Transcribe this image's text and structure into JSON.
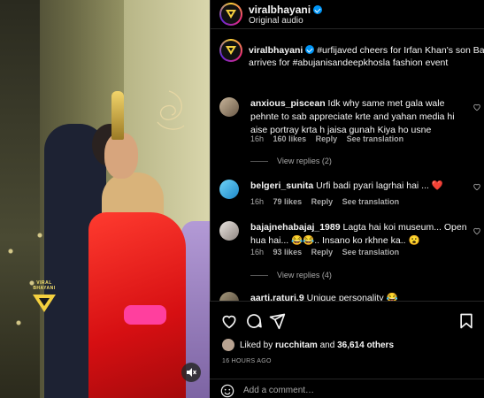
{
  "post": {
    "username": "viralbhayani",
    "audio": "Original audio",
    "caption_prefix": "#urfijaved cheers for Irfan Khan's son Babil as s",
    "caption_line2": "arrives for #abujanisandeepkhosla fashion event",
    "watermark": "VIRAL BHAYANI"
  },
  "comments": [
    {
      "username": "anxious_piscean",
      "text": "Idk why same met gala wale pehnte to sab appreciate krte and yahan media hi aise portray krta h jaisa gunah Kiya ho usne",
      "time": "16h",
      "likes": "160 likes",
      "reply": "Reply",
      "translation": "See translation",
      "view_replies": "View replies (2)"
    },
    {
      "username": "belgeri_sunita",
      "text": "Urfi badi pyari lagrhai hai ... ❤️",
      "time": "16h",
      "likes": "79 likes",
      "reply": "Reply",
      "translation": "See translation"
    },
    {
      "username": "bajajnehabajaj_1989",
      "text": "Lagta hai koi museum... Open hua hai... 😂😂.. Insano ko rkhne ka.. 😮",
      "time": "16h",
      "likes": "93 likes",
      "reply": "Reply",
      "translation": "See translation",
      "view_replies": "View replies (4)"
    },
    {
      "username": "aarti.raturi.9",
      "text": "Unique personality 😂"
    }
  ],
  "footer": {
    "liked_prefix": "Liked by",
    "liked_user": "rucchitam",
    "liked_and": "and",
    "liked_count": "36,614 others",
    "time_ago": "16 HOURS AGO",
    "add_comment_placeholder": "Add a comment…"
  },
  "colors": {
    "verified": "#0095f6",
    "heart": "#ed4956",
    "muted_text": "#a8a8a8"
  }
}
